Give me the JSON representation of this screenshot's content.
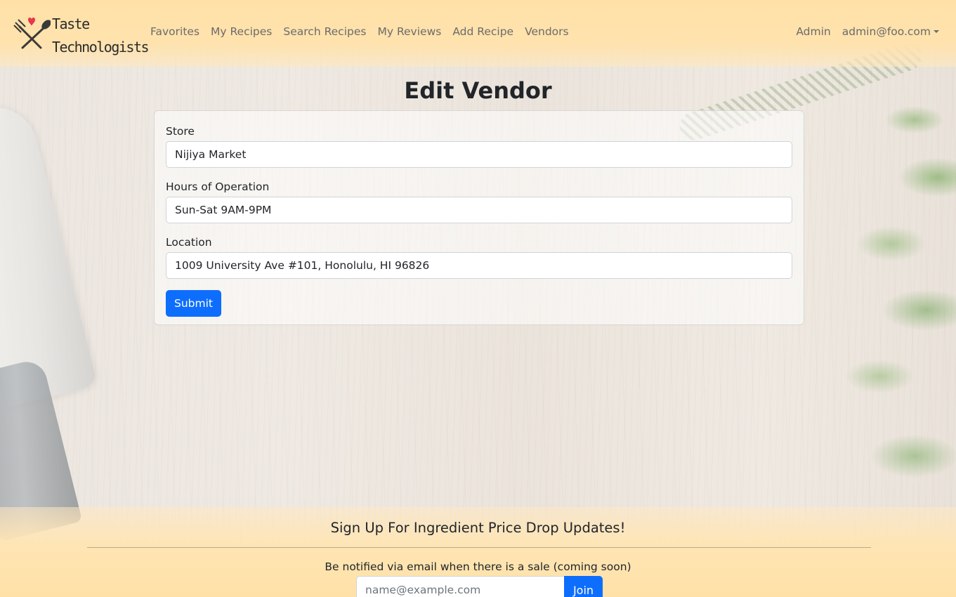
{
  "brand": {
    "line1": "Taste",
    "line2": "Technologists",
    "heart_color": "#e8374a"
  },
  "nav": {
    "links": [
      "Favorites",
      "My Recipes",
      "Search Recipes",
      "My Reviews",
      "Add Recipe",
      "Vendors"
    ],
    "admin": "Admin",
    "user_email": "admin@foo.com"
  },
  "page": {
    "title": "Edit Vendor"
  },
  "form": {
    "store_label": "Store",
    "store_value": "Nijiya Market",
    "hours_label": "Hours of Operation",
    "hours_value": "Sun-Sat 9AM-9PM",
    "location_label": "Location",
    "location_value": "1009 University Ave #101, Honolulu, HI 96826",
    "submit_label": "Submit"
  },
  "footer": {
    "title": "Sign Up For Ingredient Price Drop Updates!",
    "description": "Be notified via email when there is a sale (coming soon)",
    "email_placeholder": "name@example.com",
    "join_label": "Join"
  },
  "colors": {
    "navbar": "#ffe1a8",
    "primary": "#0d6efd"
  }
}
